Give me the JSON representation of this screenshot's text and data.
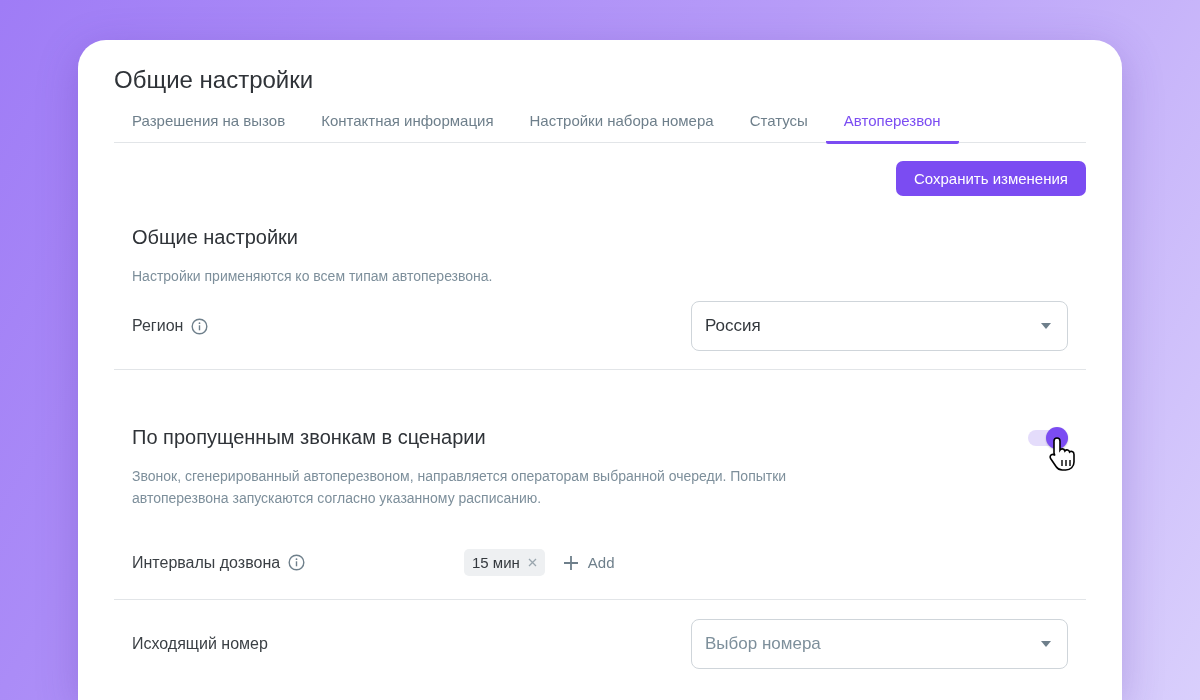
{
  "page_title": "Общие настройки",
  "tabs": [
    {
      "label": "Разрешения на вызов",
      "selected": false
    },
    {
      "label": "Контактная информация",
      "selected": false
    },
    {
      "label": "Настройки набора номера",
      "selected": false
    },
    {
      "label": "Статусы",
      "selected": false
    },
    {
      "label": "Автоперезвон",
      "selected": true
    }
  ],
  "save_button": "Сохранить изменения",
  "general": {
    "title": "Общие настройки",
    "description": "Настройки применяются ко всем типам автоперезвона.",
    "region": {
      "label": "Регион",
      "value": "Россия"
    }
  },
  "missed_calls": {
    "title": "По пропущенным звонкам в сценарии",
    "on": true,
    "description": "Звонок, сгенерированный автоперезвоном, направляется операторам выбранной очереди. Попытки автоперезвона запускаются согласно указанному расписанию.",
    "intervals": {
      "label": "Интервалы дозвона",
      "chips": [
        "15 мин"
      ],
      "add": "Add"
    },
    "outgoing": {
      "label": "Исходящий номер",
      "placeholder": "Выбор номера"
    }
  }
}
